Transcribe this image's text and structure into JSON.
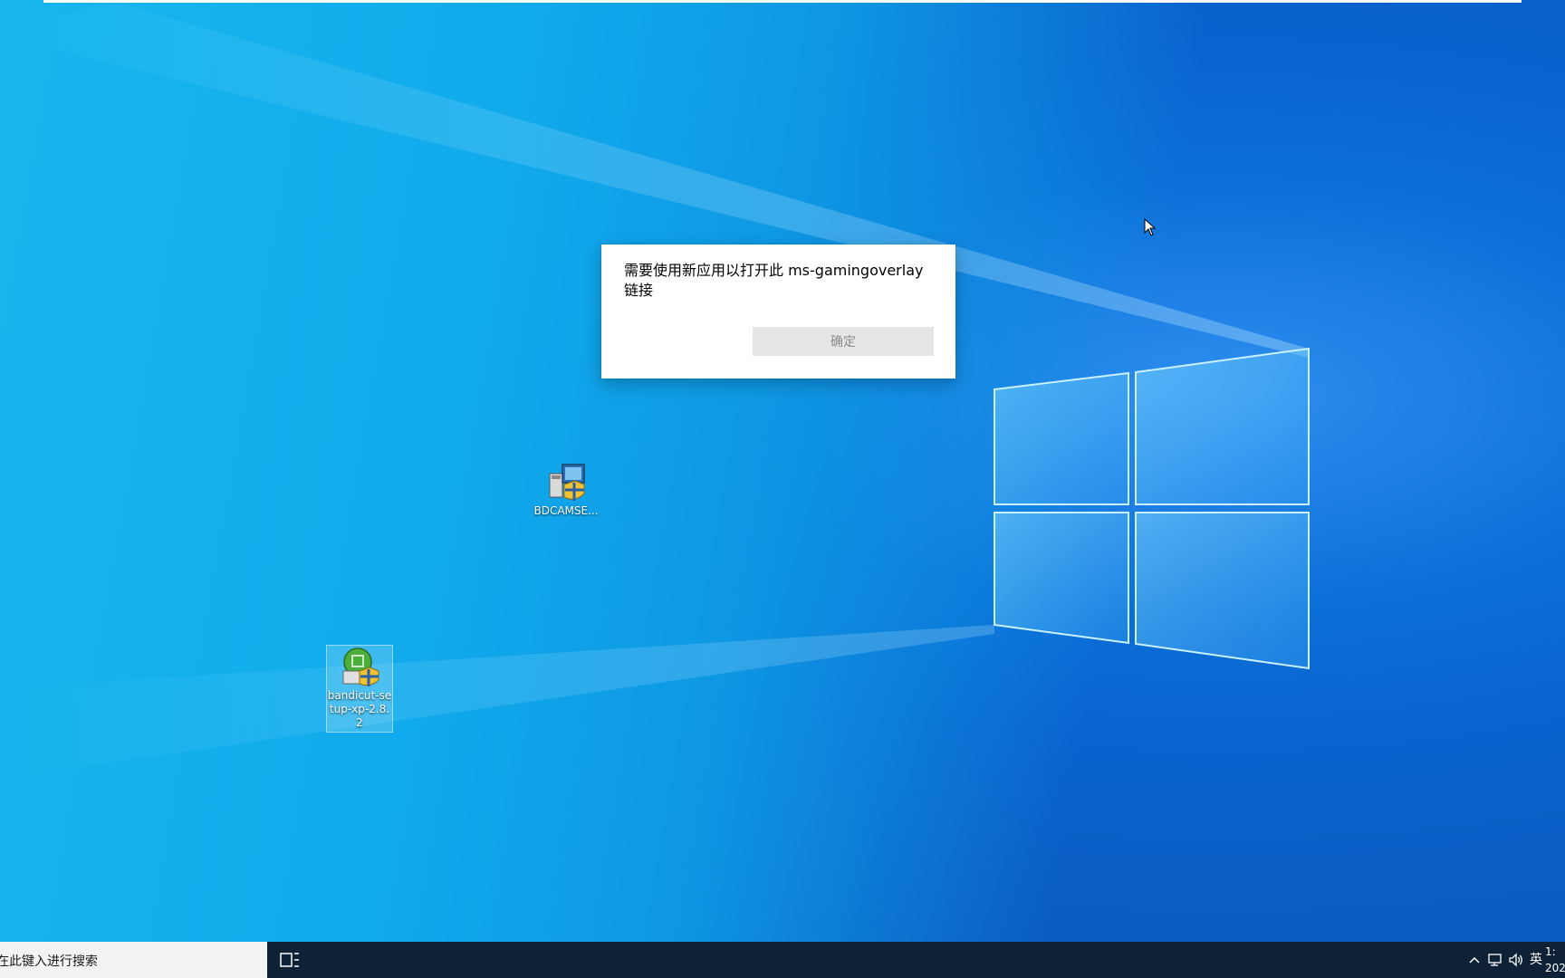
{
  "dialog": {
    "message": "需要使用新应用以打开此 ms-gamingoverlay 链接",
    "ok_label": "确定"
  },
  "desktop_icons": [
    {
      "label": "BDCAMSE...",
      "icon": "installer-icon"
    },
    {
      "label": "bandicut-setup-xp-2.8.2",
      "icon": "bandicut-installer-icon"
    }
  ],
  "taskbar": {
    "search_text": "在此键入进行搜索",
    "ime_label": "英",
    "clock_time": "1:",
    "clock_date": "202"
  },
  "colors": {
    "taskbar": "#0f2137",
    "dialog_button": "#e6e6e6",
    "wallpaper_blue": "#0b6fd8"
  }
}
